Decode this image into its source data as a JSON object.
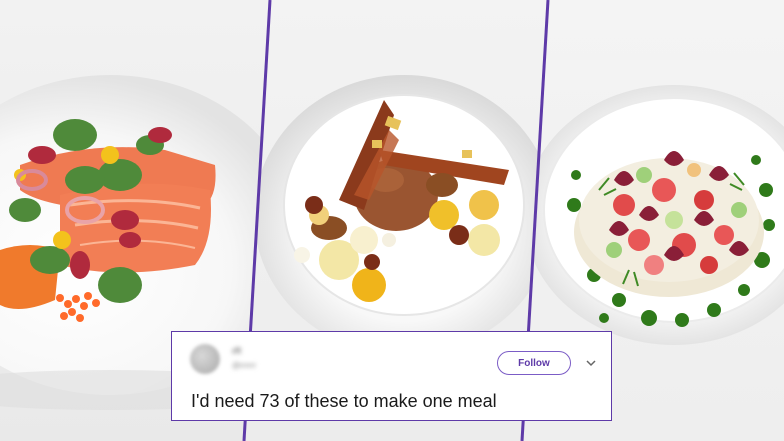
{
  "tweet": {
    "username": "rR",
    "handle": "@rrrrrr",
    "follow_label": "Follow",
    "text": "I'd need 73 of these to make one meal"
  },
  "colors": {
    "border": "#5e3aa8",
    "follow_text": "#5e3aa8"
  },
  "icons": [
    "avatar",
    "chevron-down-icon"
  ]
}
